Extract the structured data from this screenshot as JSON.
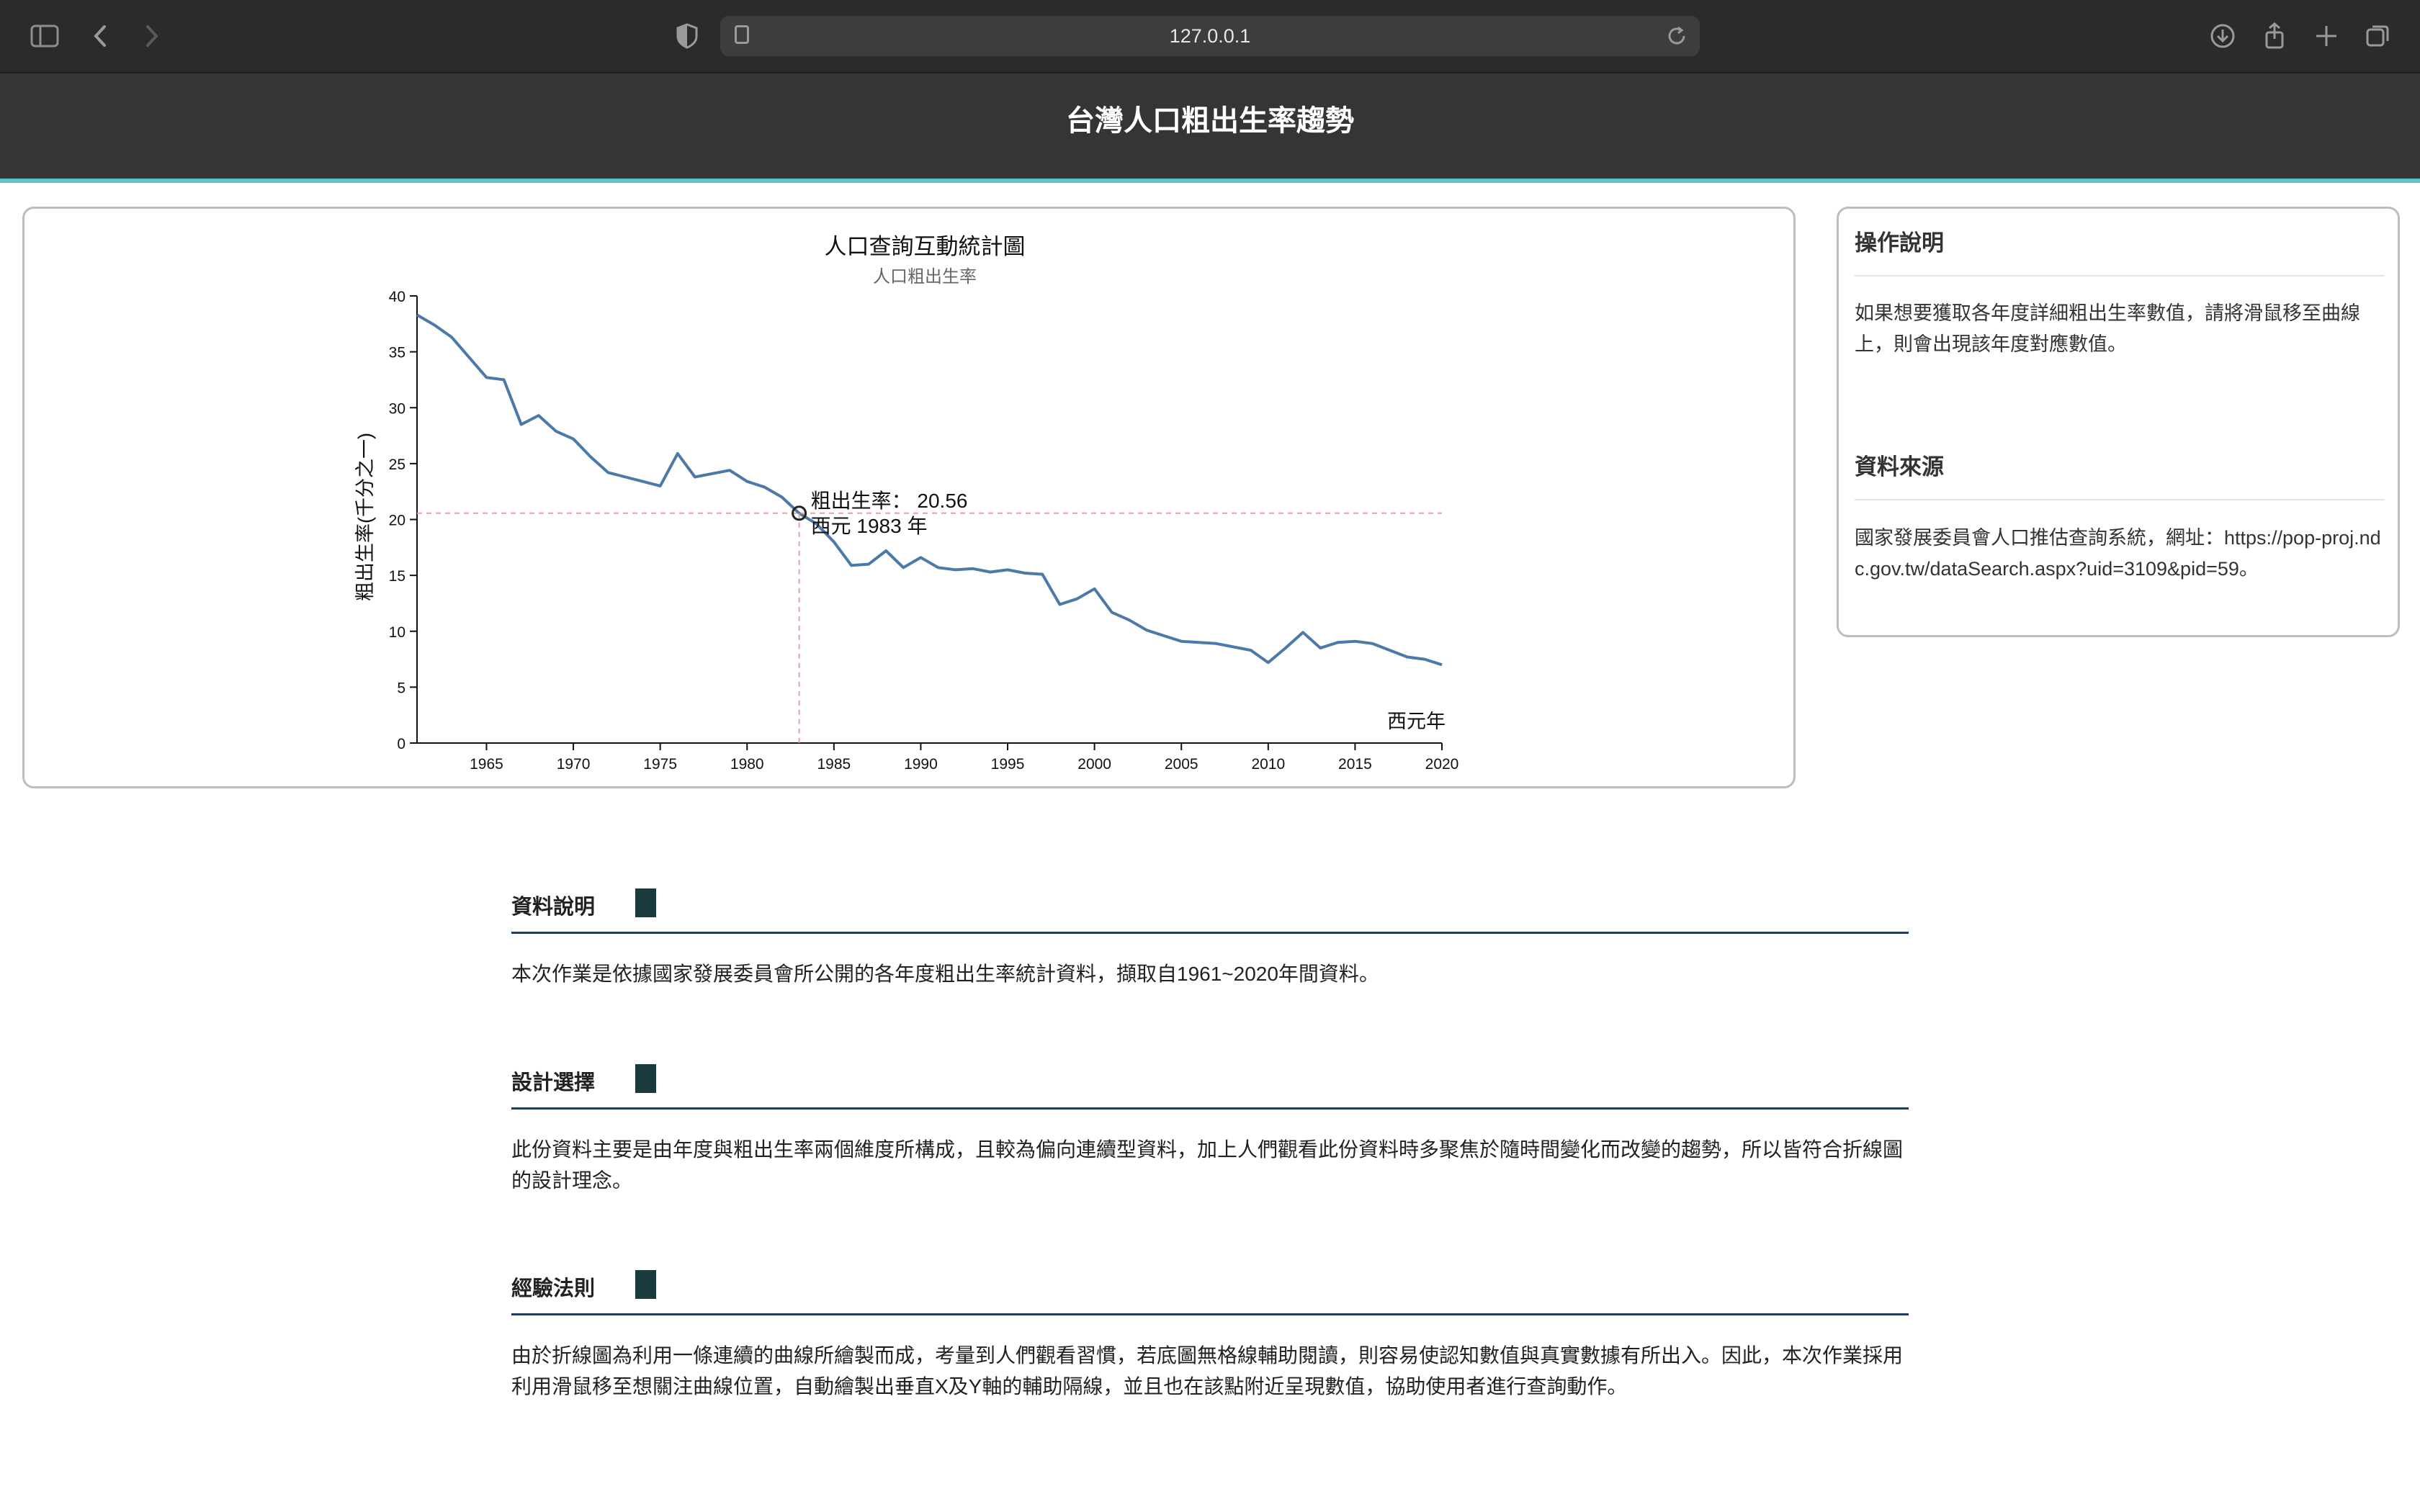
{
  "browser": {
    "url": "127.0.0.1"
  },
  "header": {
    "title": "台灣人口粗出生率趨勢"
  },
  "chart_data": {
    "type": "line",
    "title": "人口查詢互動統計圖",
    "subtitle": "人口粗出生率",
    "xlabel": "西元年",
    "ylabel": "粗出生率(千分之一)",
    "xlim": [
      1961,
      2020
    ],
    "ylim": [
      0,
      40
    ],
    "xticks": [
      1965,
      1970,
      1975,
      1980,
      1985,
      1990,
      1995,
      2000,
      2005,
      2010,
      2015,
      2020
    ],
    "yticks": [
      0,
      5,
      10,
      15,
      20,
      25,
      30,
      35,
      40
    ],
    "grid": false,
    "series": [
      {
        "color": "#4b79a8",
        "x": [
          1961,
          1962,
          1963,
          1964,
          1965,
          1966,
          1967,
          1968,
          1969,
          1970,
          1971,
          1972,
          1973,
          1974,
          1975,
          1976,
          1977,
          1978,
          1979,
          1980,
          1981,
          1982,
          1983,
          1984,
          1985,
          1986,
          1987,
          1988,
          1989,
          1990,
          1991,
          1992,
          1993,
          1994,
          1995,
          1996,
          1997,
          1998,
          1999,
          2000,
          2001,
          2002,
          2003,
          2004,
          2005,
          2006,
          2007,
          2008,
          2009,
          2010,
          2011,
          2012,
          2013,
          2014,
          2015,
          2016,
          2017,
          2018,
          2019,
          2020
        ],
        "y": [
          38.3,
          37.4,
          36.3,
          34.5,
          32.7,
          32.5,
          28.5,
          29.3,
          27.9,
          27.2,
          25.6,
          24.2,
          23.8,
          23.4,
          23.0,
          25.9,
          23.8,
          24.1,
          24.4,
          23.4,
          22.9,
          22.0,
          20.56,
          19.6,
          18.0,
          15.9,
          16.0,
          17.2,
          15.7,
          16.6,
          15.7,
          15.5,
          15.6,
          15.3,
          15.5,
          15.2,
          15.1,
          12.4,
          12.9,
          13.8,
          11.7,
          11.0,
          10.1,
          9.6,
          9.1,
          9.0,
          8.9,
          8.6,
          8.3,
          7.2,
          8.5,
          9.9,
          8.5,
          9.0,
          9.1,
          8.9,
          8.3,
          7.7,
          7.5,
          7.0
        ]
      }
    ],
    "tooltip": {
      "rate_label": "粗出生率：",
      "rate_value": "20.56",
      "year_label": "西元 1983 年",
      "year": 1983,
      "value": 20.56
    }
  },
  "guide": {
    "title": "操作說明",
    "text": "如果想要獲取各年度詳細粗出生率數值，請將滑鼠移至曲線上，則會出現該年度對應數值。"
  },
  "source": {
    "title": "資料來源",
    "text": "國家發展委員會人口推估查詢系統，網址：https://pop-proj.ndc.gov.tw/dataSearch.aspx?uid=3109&pid=59。"
  },
  "sections": [
    {
      "title": "資料說明",
      "text": "本次作業是依據國家發展委員會所公開的各年度粗出生率統計資料，擷取自1961~2020年間資料。"
    },
    {
      "title": "設計選擇",
      "text": "此份資料主要是由年度與粗出生率兩個維度所構成，且較為偏向連續型資料，加上人們觀看此份資料時多聚焦於隨時間變化而改變的趨勢，所以皆符合折線圖的設計理念。"
    },
    {
      "title": "經驗法則",
      "text": "由於折線圖為利用一條連續的曲線所繪製而成，考量到人們觀看習慣，若底圖無格線輔助閱讀，則容易使認知數值與真實數據有所出入。因此，本次作業採用利用滑鼠移至想關注曲線位置，自動繪製出垂直X及Y軸的輔助隔線，並且也在該點附近呈現數值，協助使用者進行查詢動作。"
    }
  ]
}
